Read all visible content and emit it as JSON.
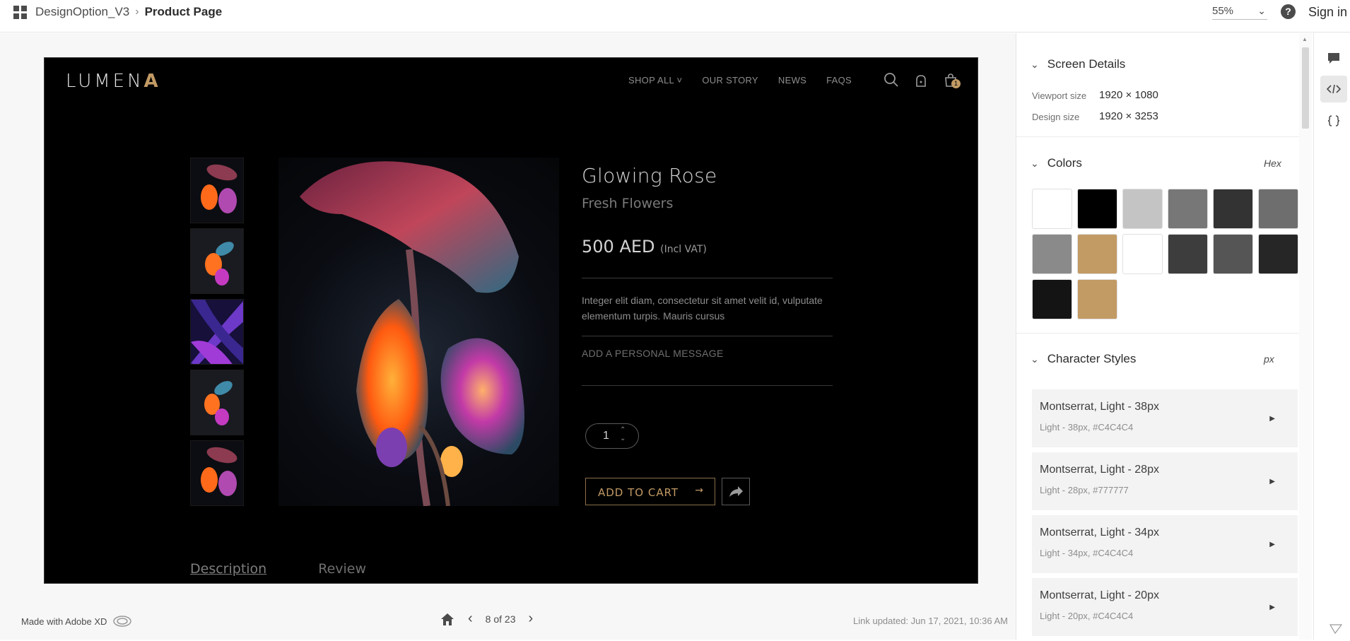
{
  "header": {
    "project": "DesignOption_V3",
    "page": "Product Page",
    "zoom": "55%",
    "help_icon": "?",
    "signin": "Sign in"
  },
  "artboard": {
    "logo": "LUMEN",
    "logo_mark": "A",
    "nav": [
      "SHOP ALL",
      "OUR STORY",
      "NEWS",
      "FAQS"
    ],
    "nav_caret": "˅",
    "cart_count": "1",
    "product": {
      "title": "Glowing Rose",
      "subtitle": "Fresh Flowers",
      "price": "500 AED",
      "price_note": "(Incl VAT)",
      "description": "Integer elit diam, consectetur sit amet velit id, vulputate elementum turpis. Mauris cursus",
      "personal_message": "ADD A PERSONAL MESSAGE",
      "quantity": "1",
      "add_to_cart": "ADD TO CART",
      "tabs": [
        "Description",
        "Review"
      ]
    }
  },
  "footer": {
    "made_with": "Made with Adobe XD",
    "page_counter": "8 of 23",
    "link_updated": "Link updated: Jun 17, 2021, 10:36 AM"
  },
  "panel": {
    "screen_details": {
      "title": "Screen Details",
      "viewport_label": "Viewport size",
      "viewport_value": "1920 × 1080",
      "design_label": "Design size",
      "design_value": "1920 × 3253"
    },
    "colors": {
      "title": "Colors",
      "format": "Hex",
      "swatches": [
        "#ffffff",
        "#000000",
        "#c4c4c4",
        "#777777",
        "#333333",
        "#6e6e6e",
        "#8a8a8a",
        "#c29a64",
        "#ffffff",
        "#3d3d3d",
        "#555555",
        "#262626",
        "#141414",
        "#c29a64"
      ]
    },
    "character_styles": {
      "title": "Character Styles",
      "unit": "px",
      "items": [
        {
          "name": "Montserrat, Light - 38px",
          "detail": "Light - 38px, #C4C4C4"
        },
        {
          "name": "Montserrat, Light - 28px",
          "detail": "Light - 28px, #777777"
        },
        {
          "name": "Montserrat, Light - 34px",
          "detail": "Light - 34px, #C4C4C4"
        },
        {
          "name": "Montserrat, Light - 20px",
          "detail": "Light - 20px, #C4C4C4"
        }
      ]
    }
  }
}
